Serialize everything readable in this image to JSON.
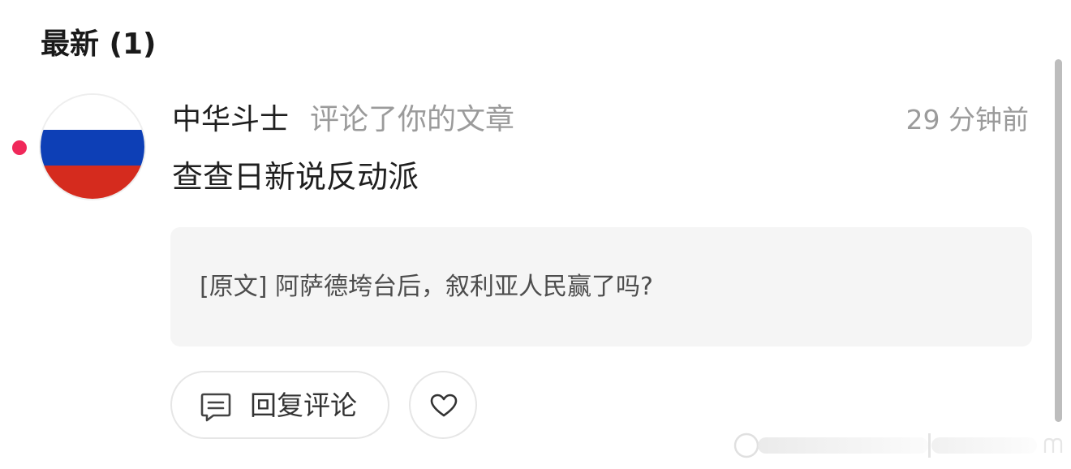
{
  "section": {
    "title": "最新 (1)"
  },
  "notification": {
    "unread": true,
    "unread_dot_color": "#f0285a",
    "avatar": {
      "icon": "russian-flag-avatar",
      "colors": [
        "#ffffff",
        "#0d3fb6",
        "#d52b1e"
      ]
    },
    "username": "中华斗士",
    "action": "评论了你的文章",
    "time": "29 分钟前",
    "comment": "查查日新说反动派",
    "original": {
      "text": "[原文] 阿萨德垮台后，叙利亚人民赢了吗?"
    }
  },
  "actions": {
    "reply_label": "回复评论",
    "reply_icon": "comment-icon",
    "like_icon": "heart-icon"
  }
}
